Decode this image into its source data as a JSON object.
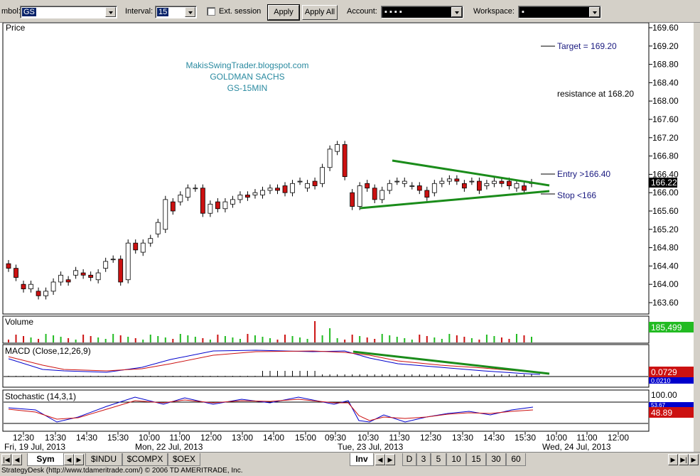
{
  "toolbar": {
    "symbol_label": "mbol:",
    "symbol_value": "GS",
    "interval_label": "Interval:",
    "interval_value": "15",
    "ext_session_label": "Ext. session",
    "apply_label": "Apply",
    "apply_all_label": "Apply All",
    "account_label": "Account:",
    "account_value": "▪ ▪ ▪ ▪",
    "workspace_label": "Workspace:",
    "workspace_value": "▪"
  },
  "chart": {
    "price_panel_title": "Price",
    "watermark": [
      "MakisSwingTrader.blogspot.com",
      "GOLDMAN SACHS",
      "GS-15MIN"
    ],
    "annotations": {
      "target": "Target = 169.20",
      "resistance": "resistance at 168.20",
      "entry": "Entry >166.40",
      "stop": "Stop <166"
    },
    "price_ticks": [
      "169.60",
      "169.20",
      "168.80",
      "168.40",
      "168.00",
      "167.60",
      "167.20",
      "166.80",
      "166.40",
      "166.00",
      "165.60",
      "165.20",
      "164.80",
      "164.40",
      "164.00",
      "163.60"
    ],
    "last_price": "166.22",
    "volume_title": "Volume",
    "volume_last": "185,499",
    "macd_title": "MACD (Close,12,26,9)",
    "macd_last": "0.0729",
    "macd_second": "0.0210",
    "stoch_title": "Stochastic (14,3,1)",
    "stoch_top": "100.00",
    "stoch_blue": "53.67",
    "stoch_red": "48.89",
    "time_labels": [
      "12:30",
      "13:30",
      "14:30",
      "15:30",
      "10:00",
      "11:00",
      "12:00",
      "13:00",
      "14:00",
      "15:00",
      "09:30",
      "10:30",
      "11:30",
      "12:30",
      "13:30",
      "14:30",
      "15:30",
      "10:00",
      "11:00",
      "12:00"
    ],
    "day_labels": [
      "Fri, 19 Jul, 2013",
      "Mon, 22 Jul, 2013",
      "Tue, 23 Jul, 2013",
      "Wed, 24 Jul, 2013"
    ],
    "colors": {
      "bull": "#ffffff",
      "bear": "#cc1111",
      "trend": "#1a8c1a",
      "text_blue": "#1a1a80",
      "watermark": "#2a8aa0"
    }
  },
  "tabs": {
    "sym": "Sym",
    "symbols": [
      "$INDU",
      "$COMPX",
      "$OEX"
    ],
    "inv": "Inv",
    "intervals": [
      "D",
      "3",
      "5",
      "10",
      "15",
      "30",
      "60"
    ]
  },
  "status": "StrategyDesk (http://www.tdameritrade.com/) © 2006 TD AMERITRADE, Inc."
}
